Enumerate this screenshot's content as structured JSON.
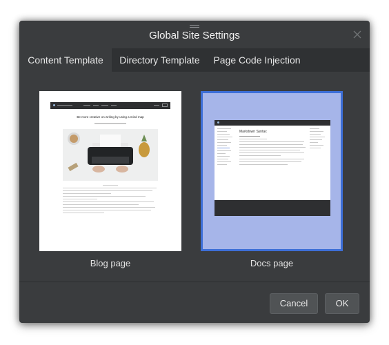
{
  "dialog": {
    "title": "Global Site Settings",
    "close_icon": "close-icon"
  },
  "tabs": [
    {
      "label": "Content Template",
      "active": true
    },
    {
      "label": "Directory Template",
      "active": false
    },
    {
      "label": "Page Code Injection",
      "active": false
    }
  ],
  "templates": [
    {
      "label": "Blog page",
      "selected": false,
      "preview_title": "Be more creative on writing by using a mind map"
    },
    {
      "label": "Docs page",
      "selected": true,
      "preview_heading": "Markdown Syntax"
    }
  ],
  "buttons": {
    "cancel": "Cancel",
    "ok": "OK"
  },
  "colors": {
    "dialog_bg": "#3a3c3e",
    "tab_bar_bg": "#2f3133",
    "selected_border": "#3d6fd7",
    "selected_fill": "#a6b5e9"
  }
}
